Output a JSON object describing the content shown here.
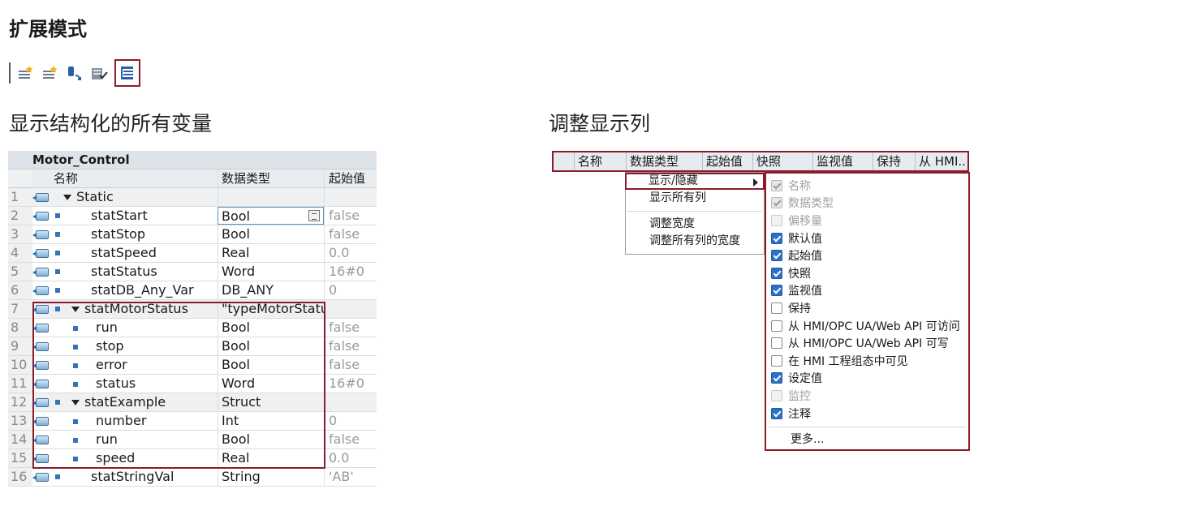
{
  "heading": "扩展模式",
  "toolbar": {
    "icons": [
      "insert-row-icon",
      "add-row-icon",
      "update-interface-icon",
      "apply-snapshot-icon",
      "expanded-mode-icon"
    ],
    "highlight_color": "#8b1c2c"
  },
  "captions": {
    "left": "显示结构化的所有变量",
    "right": "调整显示列"
  },
  "table": {
    "title": "Motor_Control",
    "headers": {
      "name": "名称",
      "type": "数据类型",
      "start": "起始值"
    },
    "rows": [
      {
        "num": "1",
        "name": "Static",
        "type": "",
        "start": ""
      },
      {
        "num": "2",
        "name": "statStart",
        "type": "Bool",
        "start": "false"
      },
      {
        "num": "3",
        "name": "statStop",
        "type": "Bool",
        "start": "false"
      },
      {
        "num": "4",
        "name": "statSpeed",
        "type": "Real",
        "start": "0.0"
      },
      {
        "num": "5",
        "name": "statStatus",
        "type": "Word",
        "start": "16#0"
      },
      {
        "num": "6",
        "name": "statDB_Any_Var",
        "type": "DB_ANY",
        "start": "0"
      },
      {
        "num": "7",
        "name": "statMotorStatus",
        "type": "\"typeMotorStatus\"",
        "start": ""
      },
      {
        "num": "8",
        "name": "run",
        "type": "Bool",
        "start": "false"
      },
      {
        "num": "9",
        "name": "stop",
        "type": "Bool",
        "start": "false"
      },
      {
        "num": "10",
        "name": "error",
        "type": "Bool",
        "start": "false"
      },
      {
        "num": "11",
        "name": "status",
        "type": "Word",
        "start": "16#0"
      },
      {
        "num": "12",
        "name": "statExample",
        "type": "Struct",
        "start": ""
      },
      {
        "num": "13",
        "name": "number",
        "type": "Int",
        "start": "0"
      },
      {
        "num": "14",
        "name": "run",
        "type": "Bool",
        "start": "false"
      },
      {
        "num": "15",
        "name": "speed",
        "type": "Real",
        "start": "0.0"
      },
      {
        "num": "16",
        "name": "statStringVal",
        "type": "String",
        "start": "'AB'"
      }
    ]
  },
  "columns_header": [
    "名称",
    "数据类型",
    "起始值",
    "快照",
    "监视值",
    "保持",
    "从 HMI.."
  ],
  "context_menu": {
    "items": [
      "显示/隐藏",
      "显示所有列",
      "调整宽度",
      "调整所有列的宽度"
    ]
  },
  "submenu": {
    "items": [
      {
        "label": "名称",
        "state": "disabled-checked"
      },
      {
        "label": "数据类型",
        "state": "disabled-checked"
      },
      {
        "label": "偏移量",
        "state": "disabled"
      },
      {
        "label": "默认值",
        "state": "checked"
      },
      {
        "label": "起始值",
        "state": "checked"
      },
      {
        "label": "快照",
        "state": "checked"
      },
      {
        "label": "监视值",
        "state": "checked"
      },
      {
        "label": "保持",
        "state": "unchecked"
      },
      {
        "label": "从 HMI/OPC UA/Web API 可访问",
        "state": "unchecked"
      },
      {
        "label": "从 HMI/OPC UA/Web API 可写",
        "state": "unchecked"
      },
      {
        "label": "在 HMI 工程组态中可见",
        "state": "unchecked"
      },
      {
        "label": "设定值",
        "state": "checked"
      },
      {
        "label": "监控",
        "state": "disabled"
      },
      {
        "label": "注释",
        "state": "checked"
      }
    ],
    "more": "更多..."
  }
}
